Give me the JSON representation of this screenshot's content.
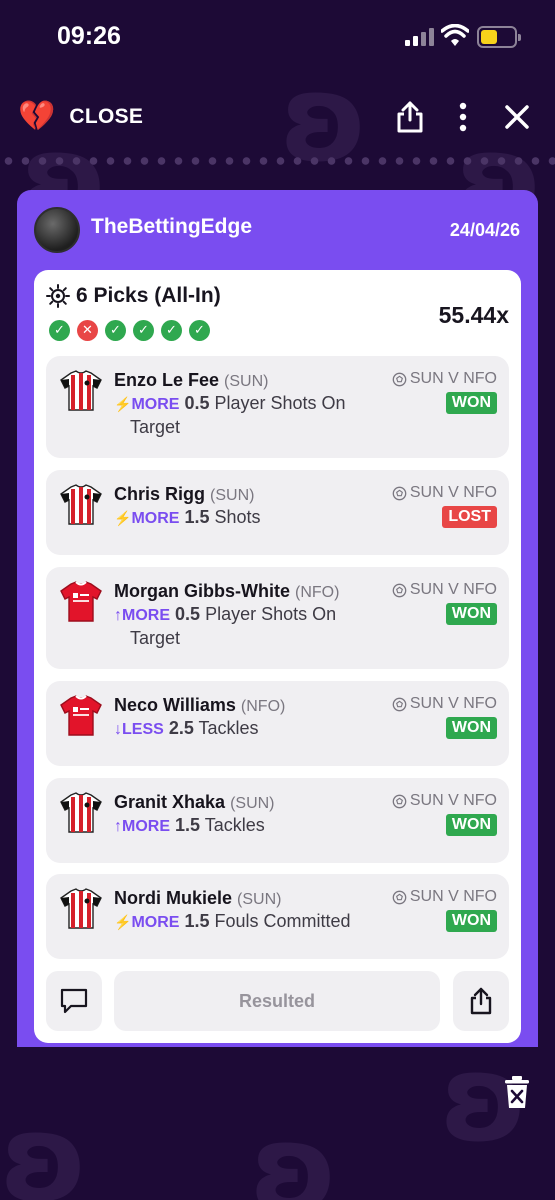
{
  "status_bar": {
    "time": "09:26"
  },
  "top_bar": {
    "close_label": "CLOSE",
    "close_icon": "broken-heart-icon"
  },
  "card": {
    "username": "TheBettingEdge",
    "date": "24/04/26",
    "summary_title": "6 Picks (All-In)",
    "multiplier": "55.44x",
    "results": [
      "won",
      "lost",
      "won",
      "won",
      "won",
      "won"
    ],
    "picks": [
      {
        "player": "Enzo Le Fee",
        "team": "(SUN)",
        "direction": "MORE",
        "dir_icon": "bolt",
        "value": "0.5",
        "stat_a": "Player Shots On",
        "stat_b": "Target",
        "match": "SUN V NFO",
        "result": "WON",
        "kit": "sun"
      },
      {
        "player": "Chris Rigg",
        "team": "(SUN)",
        "direction": "MORE",
        "dir_icon": "bolt",
        "value": "1.5",
        "stat_a": "Shots",
        "stat_b": "",
        "match": "SUN V NFO",
        "result": "LOST",
        "kit": "sun"
      },
      {
        "player": "Morgan Gibbs-White",
        "team": "(NFO)",
        "direction": "MORE",
        "dir_icon": "up-arrow",
        "value": "0.5",
        "stat_a": "Player Shots On",
        "stat_b": "Target",
        "match": "SUN V NFO",
        "result": "WON",
        "kit": "nfo"
      },
      {
        "player": "Neco Williams",
        "team": "(NFO)",
        "direction": "LESS",
        "dir_icon": "down-arrow",
        "value": "2.5",
        "stat_a": "Tackles",
        "stat_b": "",
        "match": "SUN V NFO",
        "result": "WON",
        "kit": "nfo"
      },
      {
        "player": "Granit Xhaka",
        "team": "(SUN)",
        "direction": "MORE",
        "dir_icon": "up-arrow",
        "value": "1.5",
        "stat_a": "Tackles",
        "stat_b": "",
        "match": "SUN V NFO",
        "result": "WON",
        "kit": "sun"
      },
      {
        "player": "Nordi Mukiele",
        "team": "(SUN)",
        "direction": "MORE",
        "dir_icon": "bolt",
        "value": "1.5",
        "stat_a": "Fouls Committed",
        "stat_b": "",
        "match": "SUN V NFO",
        "result": "WON",
        "kit": "sun"
      }
    ],
    "resulted_label": "Resulted"
  },
  "colors": {
    "background": "#1d0a36",
    "accent": "#7a4df0",
    "won": "#2fa84f",
    "lost": "#e84646",
    "battery": "#f7d21b"
  }
}
